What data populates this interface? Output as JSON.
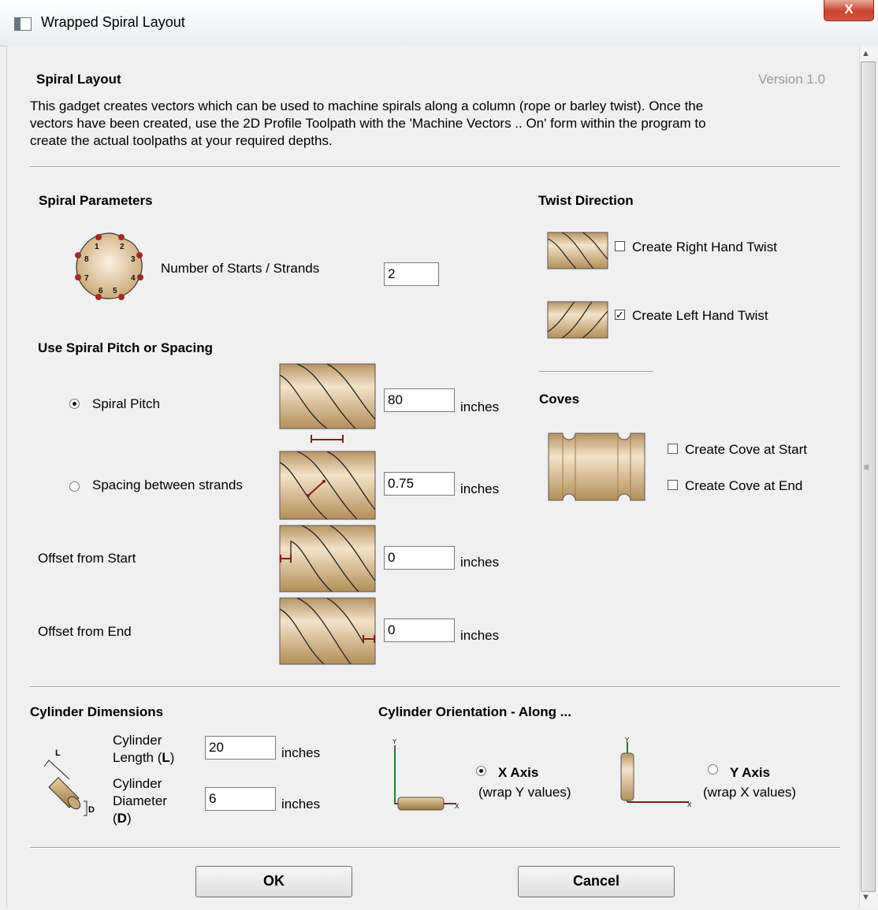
{
  "window": {
    "title": "Wrapped Spiral Layout",
    "close": "X"
  },
  "header": {
    "title": "Spiral Layout",
    "version": "Version 1.0",
    "description": [
      "This gadget creates vectors which can be used to machine spirals along a column (rope or barley twist). Once the",
      "vectors have been created, use the 2D Profile Toolpath with the 'Machine Vectors .. On' form within the program to",
      "create the actual toolpaths at your required depths."
    ]
  },
  "spiral": {
    "heading": "Spiral Parameters",
    "starts_label": "Number of Starts / Strands",
    "starts_value": "2",
    "disc_numbers": [
      "1",
      "2",
      "3",
      "4",
      "5",
      "6",
      "7",
      "8"
    ]
  },
  "pitch": {
    "heading": "Use Spiral Pitch or Spacing",
    "pitch_label": "Spiral Pitch",
    "pitch_value": "80",
    "spacing_label": "Spacing between strands",
    "spacing_value": "0.75",
    "offset_start_label": "Offset from Start",
    "offset_start_value": "0",
    "offset_end_label": "Offset from End",
    "offset_end_value": "0",
    "unit": "inches",
    "selected": "Spiral Pitch"
  },
  "twist": {
    "heading": "Twist Direction",
    "right_label": "Create Right Hand Twist",
    "right_checked": false,
    "left_label": "Create Left Hand Twist",
    "left_checked": true
  },
  "coves": {
    "heading": "Coves",
    "start_label": "Create Cove at Start",
    "end_label": "Create Cove at End"
  },
  "cylinder": {
    "heading": "Cylinder Dimensions",
    "length_label": [
      "Cylinder",
      "Length (",
      "L",
      ")"
    ],
    "length_value": "20",
    "diameter_label": [
      "Cylinder",
      "Diameter",
      "(",
      "D",
      ")"
    ],
    "diameter_value": "6",
    "unit": "inches",
    "icon_letters": [
      "L",
      "D"
    ]
  },
  "orientation": {
    "heading": "Cylinder Orientation - Along ...",
    "x_label": "X Axis",
    "x_sub": "(wrap Y values)",
    "y_label": "Y Axis",
    "y_sub": "(wrap X values)",
    "selected": "X Axis",
    "axis_letters": [
      "Y",
      "X"
    ]
  },
  "buttons": {
    "ok": "OK",
    "cancel": "Cancel"
  },
  "colors": {
    "wood": "#c9a877",
    "strand_mark": "#8b1a1a",
    "dark_line": "#2a2a2a"
  }
}
